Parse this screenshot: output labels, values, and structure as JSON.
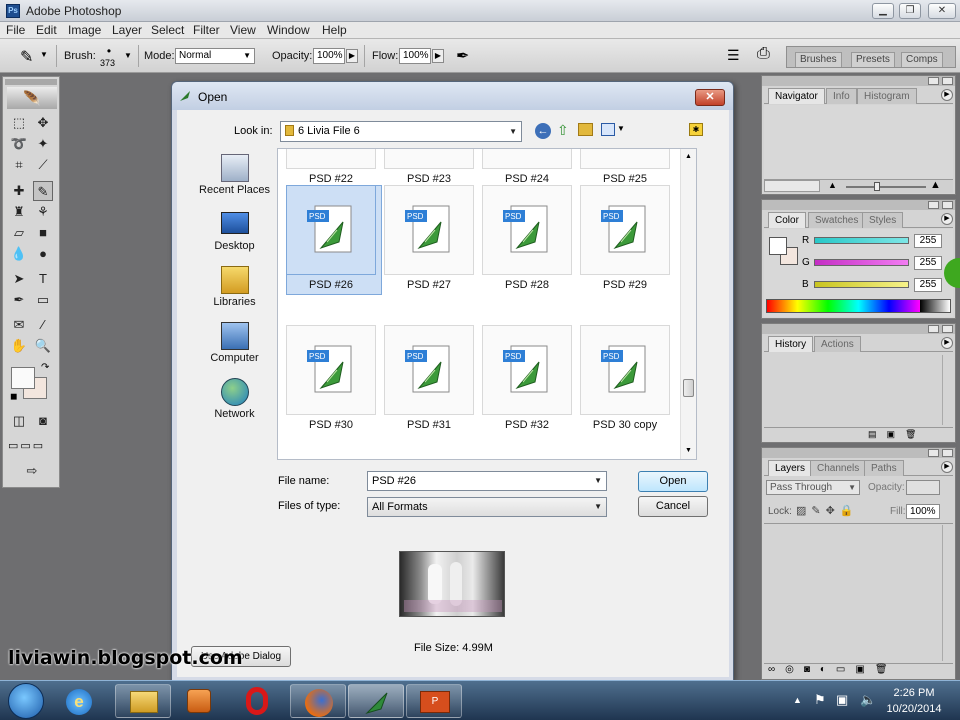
{
  "app": {
    "title": "Adobe Photoshop"
  },
  "menu": [
    "File",
    "Edit",
    "Image",
    "Layer",
    "Select",
    "Filter",
    "View",
    "Window",
    "Help"
  ],
  "options": {
    "brush_label": "Brush:",
    "brush_size": "373",
    "mode_label": "Mode:",
    "mode_value": "Normal",
    "opacity_label": "Opacity:",
    "opacity_value": "100%",
    "flow_label": "Flow:",
    "flow_value": "100%"
  },
  "palette_well": [
    "Brushes",
    "Presets",
    "Comps"
  ],
  "panels": {
    "navigator_tabs": [
      "Navigator",
      "Info",
      "Histogram"
    ],
    "color_tabs": [
      "Color",
      "Swatches",
      "Styles"
    ],
    "color": {
      "channels": [
        {
          "label": "R",
          "value": "255",
          "color": "#2fbcbc"
        },
        {
          "label": "G",
          "value": "255",
          "color": "#c53fc5"
        },
        {
          "label": "B",
          "value": "255",
          "color": "#c9c72a"
        }
      ]
    },
    "history_tabs": [
      "History",
      "Actions"
    ],
    "layers_tabs": [
      "Layers",
      "Channels",
      "Paths"
    ],
    "layers": {
      "blend": "Pass Through",
      "opacity_label": "Opacity:",
      "lock_label": "Lock:",
      "fill_label": "Fill:",
      "fill_value": "100%"
    }
  },
  "dialog": {
    "title": "Open",
    "look_in_label": "Look in:",
    "look_in_value": "6 Livia File 6",
    "places": [
      "Recent Places",
      "Desktop",
      "Libraries",
      "Computer",
      "Network"
    ],
    "files": [
      {
        "name": "PSD #22",
        "row": 0
      },
      {
        "name": "PSD #23",
        "row": 0
      },
      {
        "name": "PSD #24",
        "row": 0
      },
      {
        "name": "PSD #25",
        "row": 0
      },
      {
        "name": "PSD #26",
        "row": 1,
        "selected": true
      },
      {
        "name": "PSD #27",
        "row": 1
      },
      {
        "name": "PSD #28",
        "row": 1
      },
      {
        "name": "PSD #29",
        "row": 1
      },
      {
        "name": "PSD #30",
        "row": 2
      },
      {
        "name": "PSD #31",
        "row": 2
      },
      {
        "name": "PSD #32",
        "row": 2
      },
      {
        "name": "PSD 30 copy",
        "row": 2
      }
    ],
    "file_name_label": "File name:",
    "file_name_value": "PSD #26",
    "file_type_label": "Files of type:",
    "file_type_value": "All Formats",
    "open_button": "Open",
    "cancel_button": "Cancel",
    "file_size": "File Size: 4.99M",
    "adobe_dialog_button": "Use Adobe Dialog"
  },
  "taskbar": {
    "time": "2:26 PM",
    "date": "10/20/2014"
  },
  "watermark": "liviawin.blogspot.com"
}
